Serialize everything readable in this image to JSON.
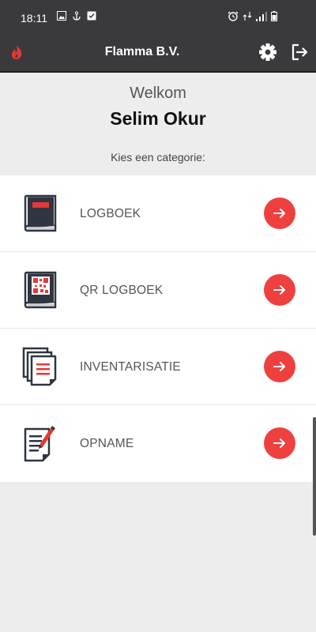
{
  "status_bar": {
    "time": "18:11"
  },
  "app_bar": {
    "title": "Flamma B.V."
  },
  "greeting": {
    "welcome": "Welkom",
    "user_name": "Selim Okur",
    "prompt": "Kies een categorie:"
  },
  "categories": [
    {
      "label": "LOGBOEK",
      "icon": "logbook-icon"
    },
    {
      "label": "QR LOGBOEK",
      "icon": "qr-logbook-icon"
    },
    {
      "label": "INVENTARISATIE",
      "icon": "inventory-documents-icon"
    },
    {
      "label": "OPNAME",
      "icon": "edit-document-icon"
    }
  ],
  "colors": {
    "accent": "#ef4040",
    "bar": "#3a3a3c",
    "background": "#ededed"
  }
}
